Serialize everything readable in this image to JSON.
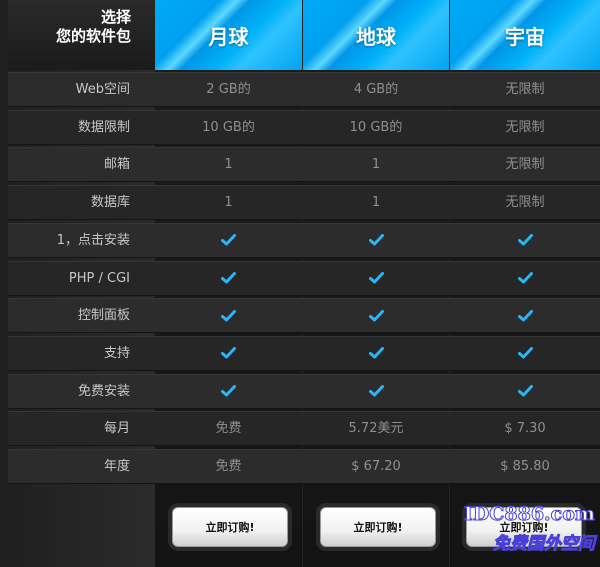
{
  "header": {
    "title_line1": "选择",
    "title_line2": "您的软件包"
  },
  "plans": [
    {
      "name": "月球",
      "buy_label": "立即订购!"
    },
    {
      "name": "地球",
      "buy_label": "立即订购!"
    },
    {
      "name": "宇宙",
      "buy_label": "立即订购!"
    }
  ],
  "rows": [
    {
      "label": "Web空间",
      "values": [
        "2 GB的",
        "4 GB的",
        "无限制"
      ]
    },
    {
      "label": "数据限制",
      "values": [
        "10 GB的",
        "10 GB的",
        "无限制"
      ]
    },
    {
      "label": "邮箱",
      "values": [
        "1",
        "1",
        "无限制"
      ]
    },
    {
      "label": "数据库",
      "values": [
        "1",
        "1",
        "无限制"
      ]
    },
    {
      "label": "1，点击安装",
      "values": [
        "check",
        "check",
        "check"
      ]
    },
    {
      "label": "PHP / CGI",
      "values": [
        "check",
        "check",
        "check"
      ]
    },
    {
      "label": "控制面板",
      "values": [
        "check",
        "check",
        "check"
      ]
    },
    {
      "label": "支持",
      "values": [
        "check",
        "check",
        "check"
      ]
    },
    {
      "label": "免费安装",
      "values": [
        "check",
        "check",
        "check"
      ]
    },
    {
      "label": "每月",
      "values": [
        "免费",
        "5.72美元",
        "$ 7.30"
      ]
    },
    {
      "label": "年度",
      "values": [
        "免费",
        "$ 67.20",
        "$ 85.80"
      ]
    }
  ],
  "watermark": {
    "line1": "IDC886.com",
    "line2": "免费国外空间"
  },
  "colors": {
    "header_blue": "#00aaf5",
    "check_blue": "#29b6f6",
    "row_bg": "#2c2c2c"
  },
  "icons": {
    "check": "check-icon"
  }
}
